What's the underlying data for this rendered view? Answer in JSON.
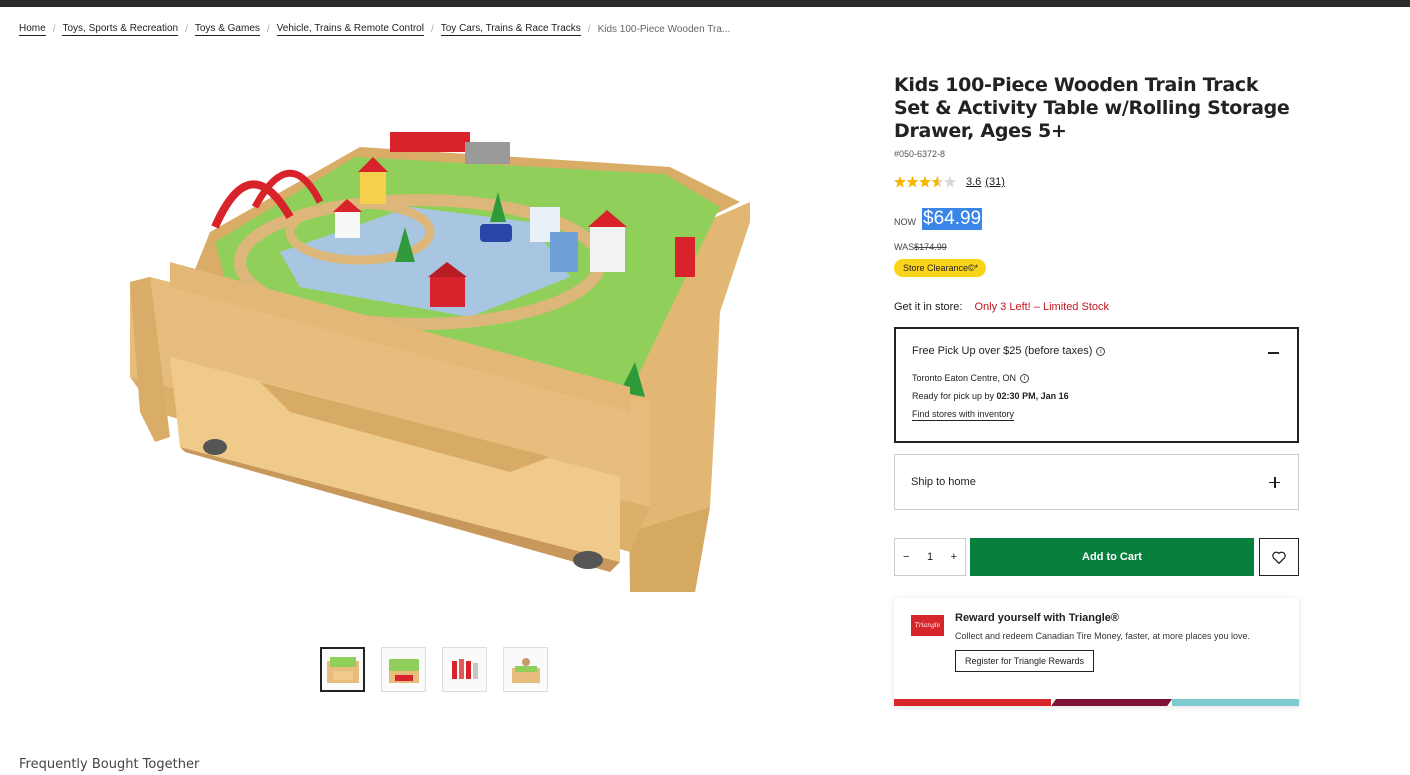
{
  "breadcrumb": [
    {
      "label": "Home"
    },
    {
      "label": "Toys, Sports & Recreation"
    },
    {
      "label": "Toys & Games"
    },
    {
      "label": "Vehicle, Trains & Remote Control"
    },
    {
      "label": "Toy Cars, Trains & Race Tracks"
    }
  ],
  "breadcrumb_current": "Kids 100-Piece Wooden Tra...",
  "product": {
    "title": "Kids 100-Piece Wooden Train Track Set & Activity Table w/Rolling Storage Drawer, Ages 5+",
    "sku": "#050-6372-8",
    "rating_value": 3.6,
    "rating_text": "3.6",
    "review_count": "(31)",
    "now_label": "NOW",
    "price": "$64.99",
    "was_label": "WAS",
    "was_price": "$174.99",
    "badge": "Store Clearance©*"
  },
  "availability": {
    "label": "Get it in store:",
    "stock": "Only 3 Left! – Limited Stock"
  },
  "pickup": {
    "title": "Free Pick Up over $25 (before taxes)",
    "store": "Toronto Eaton Centre, ON",
    "ready_prefix": "Ready for pick up by ",
    "ready_time": "02:30 PM, Jan 16",
    "find_link": "Find stores with inventory"
  },
  "ship": {
    "label": "Ship to home"
  },
  "cart": {
    "minus": "−",
    "qty": "1",
    "plus": "+",
    "add_label": "Add to Cart"
  },
  "rewards": {
    "logo": "Triangle",
    "title": "Reward yourself with Triangle®",
    "desc": "Collect and redeem Canadian Tire Money, faster, at more places you love.",
    "button": "Register for Triangle Rewards"
  },
  "section_title": "Frequently Bought Together",
  "colors": {
    "accent_green": "#07803e",
    "clearance_yellow": "#f9d41a",
    "stock_red": "#c0161b",
    "stripe": [
      "#d7262b",
      "#7c1235",
      "#7ecbcf"
    ]
  },
  "icons": [
    "star-icon",
    "info-icon",
    "minus-icon",
    "plus-icon",
    "heart-icon"
  ]
}
